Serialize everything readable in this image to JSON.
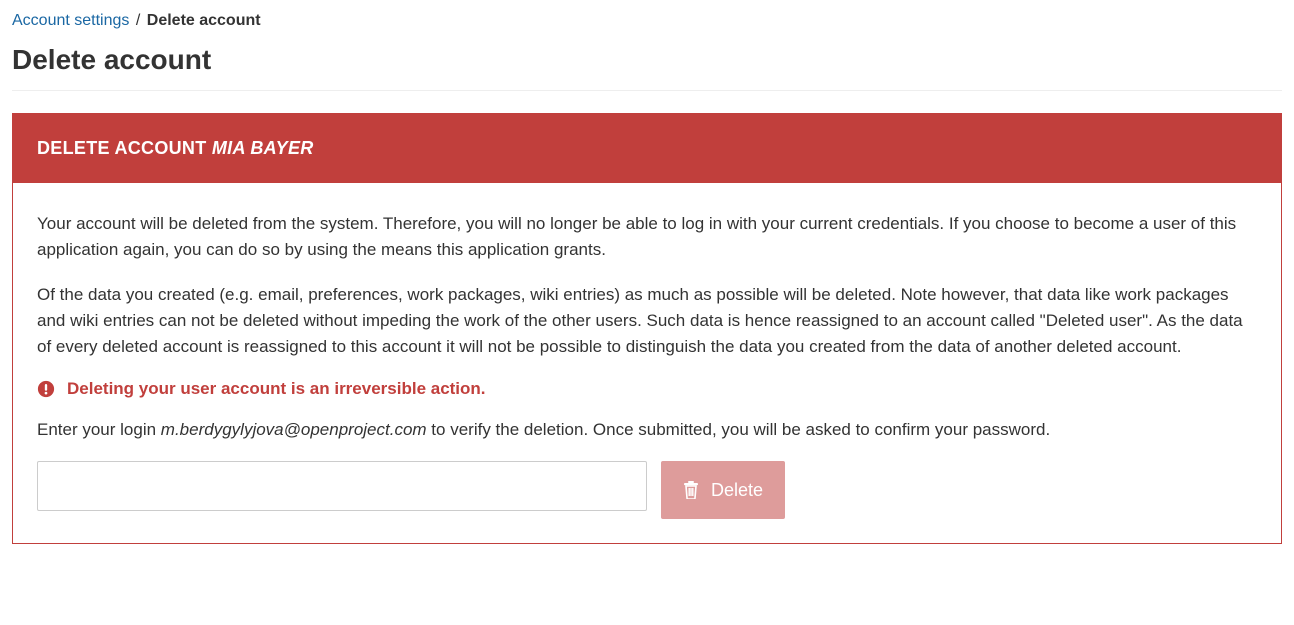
{
  "breadcrumb": {
    "parent": "Account settings",
    "separator": "/",
    "current": "Delete account"
  },
  "page_title": "Delete account",
  "box": {
    "header_prefix": "DELETE ACCOUNT ",
    "header_name": "MIA BAYER",
    "paragraph1": "Your account will be deleted from the system. Therefore, you will no longer be able to log in with your current credentials. If you choose to become a user of this application again, you can do so by using the means this application grants.",
    "paragraph2": "Of the data you created (e.g. email, preferences, work packages, wiki entries) as much as possible will be deleted. Note however, that data like work packages and wiki entries can not be deleted without impeding the work of the other users. Such data is hence reassigned to an account called \"Deleted user\". As the data of every deleted account is reassigned to this account it will not be possible to distinguish the data you created from the data of another deleted account.",
    "warning": "Deleting your user account is an irreversible action.",
    "verify_prefix": "Enter your login ",
    "verify_login": "m.berdygylyjova@openproject.com",
    "verify_suffix": " to verify the deletion. Once submitted, you will be asked to confirm your password.",
    "input_value": "",
    "delete_label": "Delete"
  }
}
